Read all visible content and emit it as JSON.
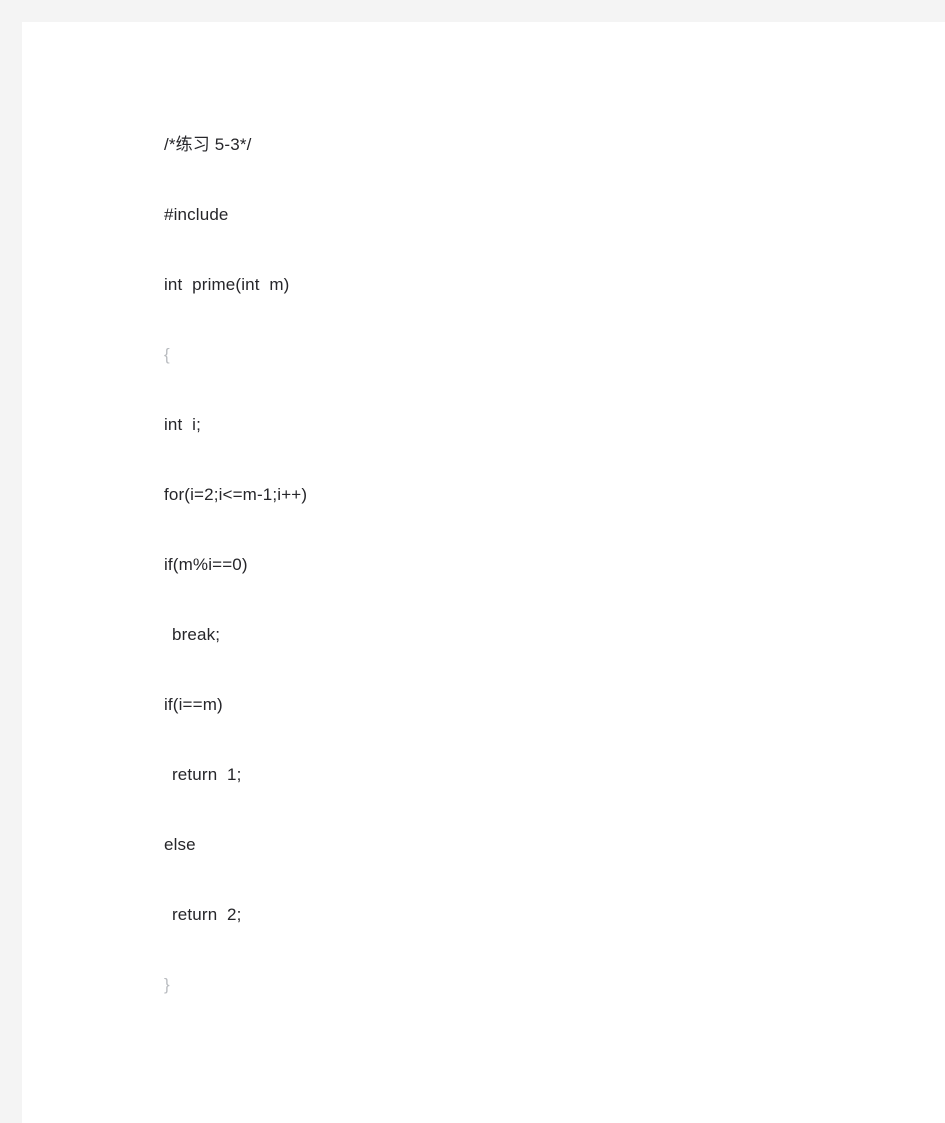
{
  "document": {
    "background_color": "#f4f4f4",
    "page_color": "#ffffff",
    "text_color": "#26262a",
    "brace_color": "#b9bcc0",
    "lines": [
      {
        "text": "/*练习 5-3*/",
        "style": "normal"
      },
      {
        "text": "#include",
        "style": "normal"
      },
      {
        "text": "int  prime(int  m)",
        "style": "normal"
      },
      {
        "text": "{",
        "style": "brace"
      },
      {
        "text": "int  i;",
        "style": "normal"
      },
      {
        "text": "for(i=2;i<=m-1;i++)",
        "style": "normal"
      },
      {
        "text": "if(m%i==0)",
        "style": "normal"
      },
      {
        "text": "break;",
        "style": "indent"
      },
      {
        "text": "if(i==m)",
        "style": "normal"
      },
      {
        "text": "return  1;",
        "style": "indent"
      },
      {
        "text": "else",
        "style": "normal"
      },
      {
        "text": "return  2;",
        "style": "indent"
      },
      {
        "text": "}",
        "style": "brace"
      }
    ]
  }
}
